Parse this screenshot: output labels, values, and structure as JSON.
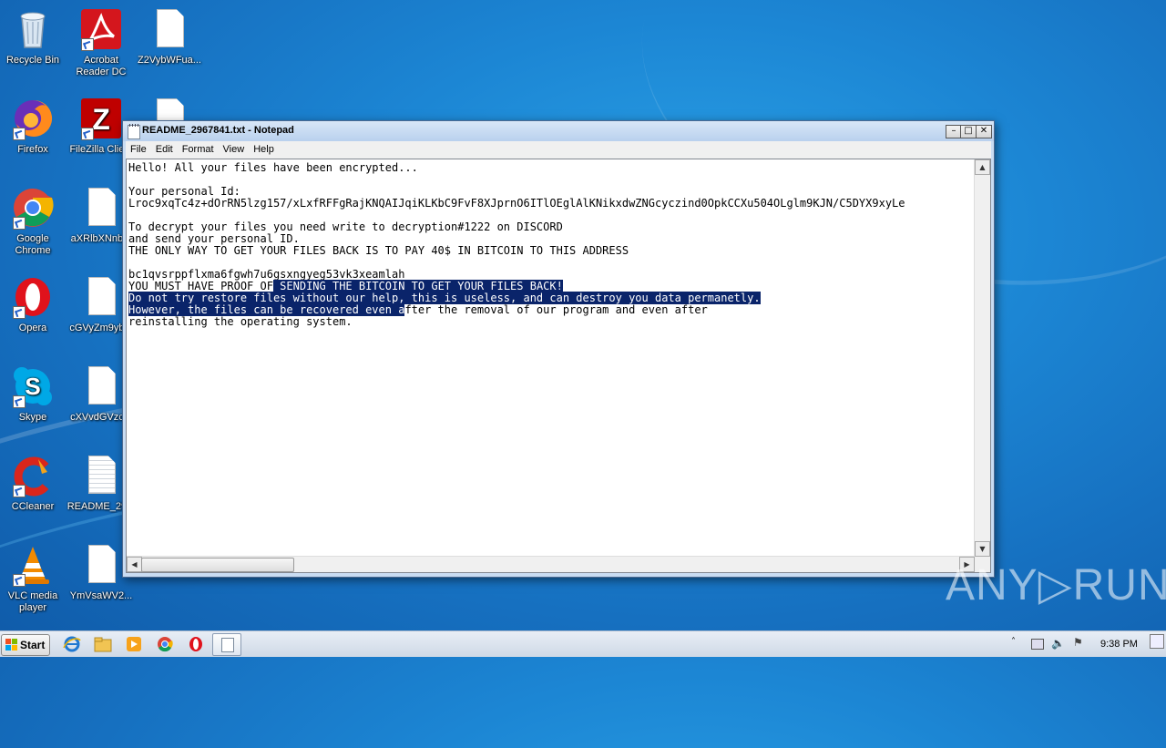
{
  "desktop": {
    "icons": [
      {
        "label": "Recycle Bin"
      },
      {
        "label": "Acrobat Reader DC"
      },
      {
        "label": "Z2VybWFua..."
      },
      {
        "label": "Firefox"
      },
      {
        "label": "FileZilla Clie..."
      },
      {
        "label": "Google Chrome"
      },
      {
        "label": "aXRlbXNnb..."
      },
      {
        "label": "Opera"
      },
      {
        "label": "cGVyZm9yb..."
      },
      {
        "label": "Skype"
      },
      {
        "label": "cXVvdGVzc..."
      },
      {
        "label": "CCleaner"
      },
      {
        "label": "README_29..."
      },
      {
        "label": "VLC media player"
      },
      {
        "label": "YmVsaWV2..."
      }
    ]
  },
  "notepad": {
    "title": "README_2967841.txt - Notepad",
    "menu": [
      "File",
      "Edit",
      "Format",
      "View",
      "Help"
    ],
    "lines": [
      "Hello! All your files have been encrypted...",
      "",
      "Your personal Id:",
      "Lroc9xqTc4z+dOrRN5lzg157/xLxfRFFgRajKNQAIJqiKLKbC9FvF8XJprnO6ITlOEglAlKNikxdwZNGcyczind0OpkCCXu504OLglm9KJN/C5DYX9xyLe",
      "",
      "To decrypt your files you need write to decryption#1222 on DISCORD",
      "and send your personal ID.",
      "THE ONLY WAY TO GET YOUR FILES BACK IS TO PAY 40$ IN BITCOIN TO THIS ADDRESS",
      "",
      "bc1qvsrppflxma6fgwh7u6gsxngyeg53vk3xeamlah"
    ],
    "selected_line_1_pre": "YOU MUST HAVE PROOF OF",
    "selected_line_1_sel": " SENDING THE BITCOIN TO GET YOUR FILES BACK!",
    "selected_line_2": "Do not try restore files without our help, this is useless, and can destroy you data permanetly.",
    "selected_line_3_sel": "However, the files can be recovered even a",
    "selected_line_3_post": "fter the removal of our program and even after",
    "last_line": "reinstalling the operating system."
  },
  "taskbar": {
    "start_label": "Start",
    "clock": "9:38 PM"
  },
  "watermark": "ANY▷RUN"
}
